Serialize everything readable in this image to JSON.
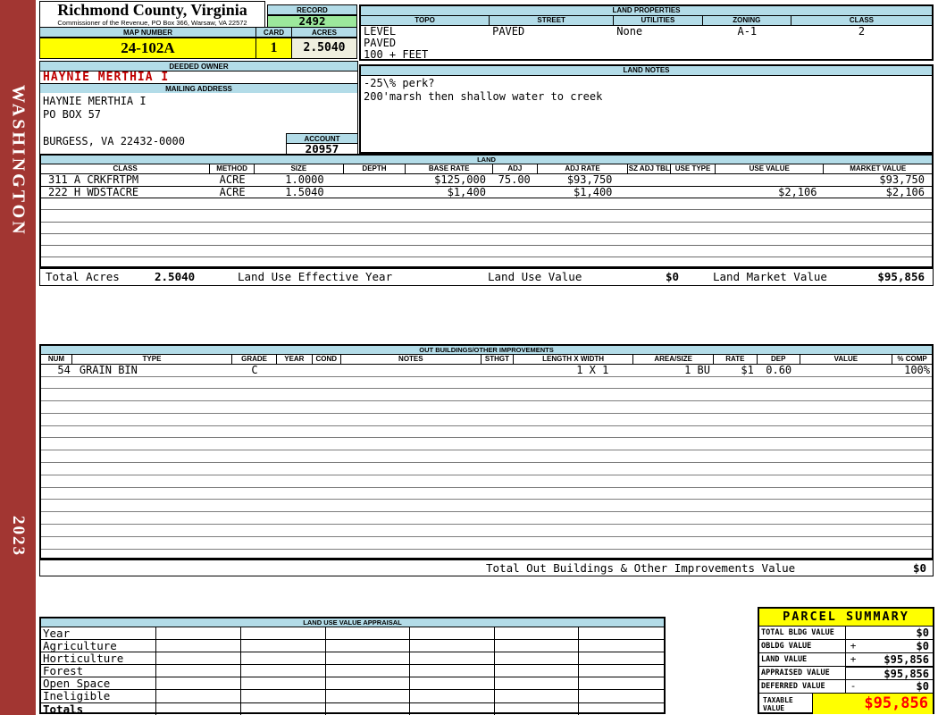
{
  "sidebar": {
    "district": "WASHINGTON",
    "year": "2023"
  },
  "header": {
    "county": "Richmond County, Virginia",
    "office_line": "Commissioner of the Revenue, PO Box 366, Warsaw, VA 22572",
    "record_label": "RECORD",
    "record": "2492",
    "map_number_label": "MAP NUMBER",
    "map_number": "24-102A",
    "card_label": "CARD",
    "card": "1",
    "acres_label": "ACRES",
    "acres": "2.5040"
  },
  "land_properties": {
    "title": "LAND PROPERTIES",
    "columns": [
      "TOPO",
      "STREET",
      "UTILITIES",
      "ZONING",
      "CLASS"
    ],
    "topo_line1": "LEVEL",
    "topo_line2": "PAVED",
    "topo_line3": "100 + FEET",
    "street": "PAVED",
    "utilities": "None",
    "zoning": "A-1",
    "class": "2"
  },
  "owner": {
    "deeded_owner_label": "DEEDED OWNER",
    "deeded_owner": "HAYNIE MERTHIA I",
    "mailing_address_label": "MAILING ADDRESS",
    "address_lines": [
      "HAYNIE MERTHIA I",
      "PO BOX 57",
      "",
      "BURGESS, VA 22432-0000"
    ],
    "account_label": "ACCOUNT",
    "account": "20957"
  },
  "land_notes": {
    "title": "LAND NOTES",
    "lines": [
      "-25\\% perk?",
      "200'marsh then shallow water to creek"
    ]
  },
  "land": {
    "title": "LAND",
    "columns": [
      "CLASS",
      "METHOD",
      "SIZE",
      "DEPTH",
      "BASE RATE",
      "ADJ",
      "ADJ RATE",
      "SZ ADJ TBL",
      "USE TYPE",
      "USE VALUE",
      "MARKET VALUE"
    ],
    "rows": [
      {
        "cls": "311 A CRKFRTPM",
        "method": "ACRE",
        "size": "1.0000",
        "depth": "",
        "base_rate": "$125,000",
        "adj": "75.00",
        "adj_rate": "$93,750",
        "sz_adj_tbl": "",
        "use_type": "",
        "use_value": "",
        "market_value": "$93,750"
      },
      {
        "cls": "222 H WDSTACRE",
        "method": "ACRE",
        "size": "1.5040",
        "depth": "",
        "base_rate": "$1,400",
        "adj": "",
        "adj_rate": "$1,400",
        "sz_adj_tbl": "",
        "use_type": "",
        "use_value": "$2,106",
        "market_value": "$2,106"
      }
    ],
    "totals": {
      "total_acres_label": "Total Acres",
      "total_acres": "2.5040",
      "effective_year_label": "Land Use Effective Year",
      "use_value_label": "Land Use Value",
      "use_value": "$0",
      "market_value_label": "Land Market Value",
      "market_value": "$95,856"
    }
  },
  "out_buildings": {
    "title": "OUT BUILDINGS/OTHER IMPROVEMENTS",
    "columns": [
      "NUM",
      "TYPE",
      "GRADE",
      "YEAR",
      "COND",
      "NOTES",
      "STHGT",
      "LENGTH X WIDTH",
      "AREA/SIZE",
      "RATE",
      "DEP",
      "VALUE",
      "% COMP"
    ],
    "rows": [
      {
        "num": "54",
        "type": "GRAIN BIN",
        "grade": "C",
        "year": "",
        "cond": "",
        "notes": "",
        "sthgt": "",
        "length_x_width": "1 X 1",
        "area_size": "1 BU",
        "rate": "$1",
        "dep": "0.60",
        "value": "",
        "pct_comp": "100%"
      }
    ],
    "total_label": "Total Out Buildings & Other Improvements Value",
    "total_value": "$0"
  },
  "appraisal": {
    "title": "LAND USE VALUE APPRAISAL",
    "row_labels": [
      "Year",
      "Agriculture",
      "Horticulture",
      "Forest",
      "Open Space",
      "Ineligible",
      "Totals"
    ]
  },
  "parcel_summary": {
    "title": "PARCEL SUMMARY",
    "rows": [
      {
        "label": "TOTAL BLDG VALUE",
        "sign": "",
        "value": "$0"
      },
      {
        "label": "OBLDG VALUE",
        "sign": "+",
        "value": "$0"
      },
      {
        "label": "LAND VALUE",
        "sign": "+",
        "value": "$95,856"
      },
      {
        "label": "APPRAISED VALUE",
        "sign": "",
        "value": "$95,856"
      },
      {
        "label": "DEFERRED VALUE",
        "sign": "-",
        "value": "$0"
      }
    ],
    "taxable_label": "TAXABLE VALUE",
    "taxable_value": "$95,856"
  },
  "colors": {
    "sidebar_red": "#A23632",
    "header_blue": "#B3DCE8",
    "record_green": "#9CE89C",
    "highlight_yellow": "#FFFF00",
    "acres_cream": "#EFEFDE",
    "owner_red": "#C00000",
    "taxable_red": "#FF0000"
  }
}
